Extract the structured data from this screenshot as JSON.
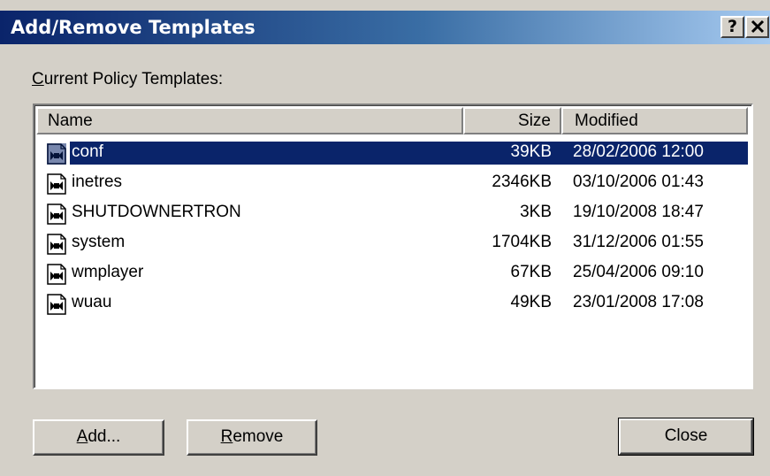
{
  "window": {
    "title": "Add/Remove Templates",
    "help_label": "?",
    "close_label": "✕"
  },
  "section": {
    "label_first": "C",
    "label_rest": "urrent Policy Templates:"
  },
  "columns": {
    "name": "Name",
    "size": "Size",
    "modified": "Modified"
  },
  "templates": [
    {
      "name": "conf",
      "size": "39KB",
      "modified": "28/02/2006 12:00",
      "selected": true
    },
    {
      "name": "inetres",
      "size": "2346KB",
      "modified": "03/10/2006 01:43",
      "selected": false
    },
    {
      "name": "SHUTDOWNERTRON",
      "size": "3KB",
      "modified": "19/10/2008 18:47",
      "selected": false
    },
    {
      "name": "system",
      "size": "1704KB",
      "modified": "31/12/2006 01:55",
      "selected": false
    },
    {
      "name": "wmplayer",
      "size": "67KB",
      "modified": "25/04/2006 09:10",
      "selected": false
    },
    {
      "name": "wuau",
      "size": "49KB",
      "modified": "23/01/2008 17:08",
      "selected": false
    }
  ],
  "buttons": {
    "add_first": "A",
    "add_rest": "dd...",
    "remove_first": "R",
    "remove_rest": "emove",
    "close": "Close"
  },
  "icons": {
    "template_file": "policy-template-file-icon"
  }
}
